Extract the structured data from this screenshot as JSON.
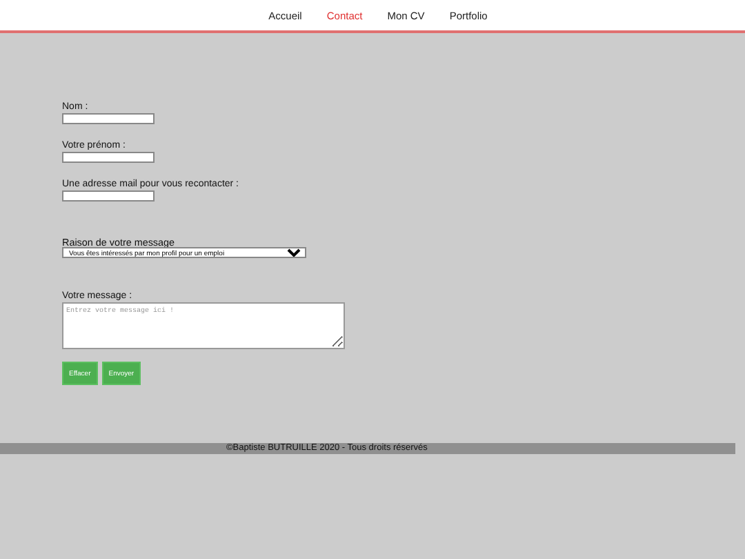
{
  "nav": [
    {
      "label": "Accueil",
      "selected": false
    },
    {
      "label": "Contact",
      "selected": true
    },
    {
      "label": "Mon CV",
      "selected": false
    },
    {
      "label": "Portfolio",
      "selected": false
    }
  ],
  "form": {
    "fields": [
      {
        "label": "Nom :"
      },
      {
        "label": "Votre prénom :"
      },
      {
        "label": "Une adresse mail pour vous recontacter :"
      }
    ],
    "reason": {
      "label": "Raison de votre message",
      "value": "Vous êtes intéressés par mon profil pour un emploi"
    },
    "message": {
      "label": "Votre message :",
      "placeholder": "Entrez votre message ici !"
    },
    "buttons": [
      "Effacer",
      "Envoyer"
    ]
  },
  "footer": "©Baptiste BUTRUILLE 2020 - Tous droits réservés"
}
